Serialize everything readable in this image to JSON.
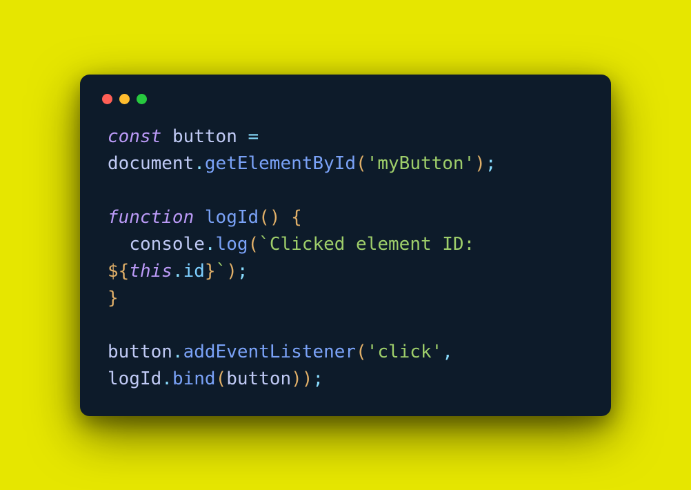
{
  "window": {
    "traffic_lights": {
      "red": "#ff5f56",
      "yellow": "#ffbd2e",
      "green": "#27c93f"
    }
  },
  "code": {
    "l1": {
      "const": "const",
      "sp": " ",
      "button": "button",
      "eq": " ="
    },
    "l2": {
      "document": "document",
      "dot": ".",
      "getElementById": "getElementById",
      "lp": "(",
      "str": "'myButton'",
      "rp": ")",
      "semi": ";"
    },
    "l3": "",
    "l4": {
      "function": "function",
      "sp": " ",
      "logId": "logId",
      "lp": "(",
      "rp": ")",
      "lb": " {"
    },
    "l5": {
      "indent": "  ",
      "console": "console",
      "dot": ".",
      "log": "log",
      "lp": "(",
      "tick1": "`",
      "text1": "Clicked element ID: "
    },
    "l6": {
      "interp_open": "${",
      "this": "this",
      "dot": ".",
      "id": "id",
      "interp_close": "}",
      "tick2": "`",
      "rp": ")",
      "semi": ";"
    },
    "l7": {
      "rb": "}"
    },
    "l8": "",
    "l9": {
      "button": "button",
      "dot1": ".",
      "addEventListener": "addEventListener",
      "lp": "(",
      "str": "'click'",
      "comma": ","
    },
    "l10": {
      "logId": "logId",
      "dot": ".",
      "bind": "bind",
      "lp": "(",
      "button": "button",
      "rp1": ")",
      "rp2": ")",
      "semi": ";"
    }
  }
}
